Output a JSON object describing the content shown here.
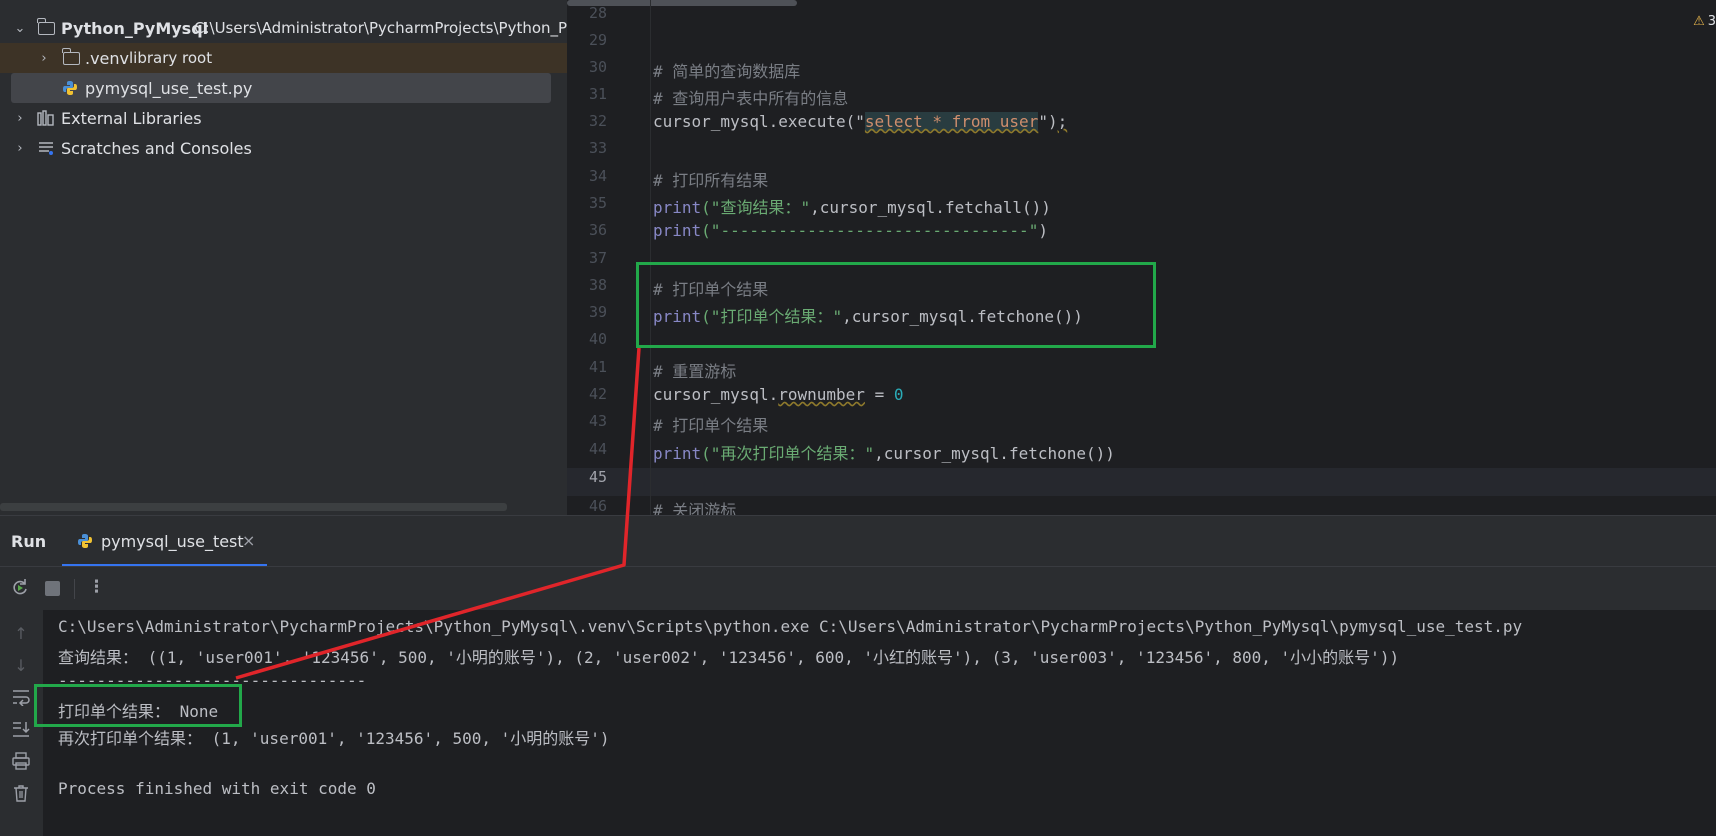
{
  "project": {
    "root_name": "Python_PyMysql",
    "root_path": "C:\\Users\\Administrator\\PycharmProjects\\Python_Py",
    "venv_name": ".venv",
    "venv_hint": "library root",
    "file_name": "pymysql_use_test.py",
    "external_libraries": "External Libraries",
    "scratches": "Scratches and Consoles"
  },
  "editor": {
    "warning_count": "3",
    "line_numbers": [
      "28",
      "29",
      "30",
      "31",
      "32",
      "33",
      "34",
      "35",
      "36",
      "37",
      "38",
      "39",
      "40",
      "41",
      "42",
      "43",
      "44",
      "45",
      "46"
    ],
    "lines": {
      "l30": "# 简单的查询数据库",
      "l31": "# 查询用户表中所有的信息",
      "l32_a": "cursor_mysql.execute(\"",
      "l32_sql": "select * from user",
      "l32_b": "\")",
      "l32_c": ";",
      "l34": "# 打印所有结果",
      "l35_fn": "print",
      "l35_str": "(\"查询结果：\"",
      "l35_rest": ",cursor_mysql.fetchall())",
      "l36_fn": "print",
      "l36_str": "(\"--------------------------------\"",
      "l36_rest": ")",
      "l38": "# 打印单个结果",
      "l39_fn": "print",
      "l39_str": "(\"打印单个结果：\"",
      "l39_rest": ",cursor_mysql.fetchone())",
      "l41": "# 重置游标",
      "l42_a": "cursor_mysql.",
      "l42_attr": "rownumber",
      "l42_b": " = ",
      "l42_num": "0",
      "l43": "# 打印单个结果",
      "l44_fn": "print",
      "l44_str": "(\"再次打印单个结果：\"",
      "l44_rest": ",cursor_mysql.fetchone())",
      "l46": "# 关闭游标"
    }
  },
  "run": {
    "title": "Run",
    "tab_label": "pymysql_use_test",
    "close_glyph": "×"
  },
  "console": {
    "lines": [
      "C:\\Users\\Administrator\\PycharmProjects\\Python_PyMysql\\.venv\\Scripts\\python.exe C:\\Users\\Administrator\\PycharmProjects\\Python_PyMysql\\pymysql_use_test.py",
      "查询结果： ((1, 'user001', '123456', 500, '小明的账号'), (2, 'user002', '123456', 600, '小红的账号'), (3, 'user003', '123456', 800, '小小的账号'))",
      "--------------------------------",
      "打印单个结果： None",
      "再次打印单个结果： (1, 'user001', '123456', 500, '小明的账号')",
      "",
      "Process finished with exit code 0"
    ]
  },
  "icons": {
    "rerun": "rerun-icon",
    "stop": "stop-icon",
    "more": "more-icon",
    "python_file": "python-file-icon"
  },
  "colors": {
    "annotation_box": "#22a84a",
    "annotation_arrow": "#e0252a",
    "tab_underline": "#3574f0"
  }
}
